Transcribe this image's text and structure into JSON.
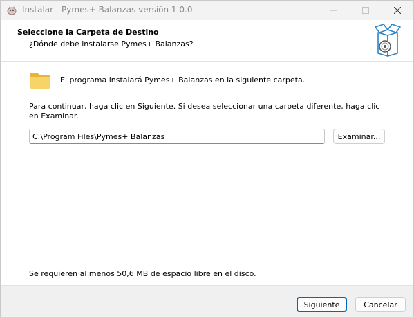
{
  "window": {
    "title": "Instalar - Pymes+ Balanzas versión 1.0.0"
  },
  "header": {
    "title": "Seleccione la Carpeta de Destino",
    "subtitle": "¿Dónde debe instalarse Pymes+ Balanzas?"
  },
  "body": {
    "folder_message": "El programa instalará Pymes+ Balanzas en la siguiente carpeta.",
    "instructions": "Para continuar, haga clic en Siguiente. Si desea seleccionar una carpeta diferente, haga clic en Examinar.",
    "path_value": "C:\\Program Files\\Pymes+ Balanzas",
    "browse_label": "Examinar...",
    "space_required": "Se requieren al menos 50,6 MB de espacio libre en el disco."
  },
  "footer": {
    "next_label": "Siguiente",
    "cancel_label": "Cancelar"
  },
  "icons": {
    "app": "installer-app-icon",
    "folder": "folder-icon",
    "box": "software-box-icon"
  },
  "colors": {
    "accent": "#0067c0",
    "folder": "#f4c94a"
  }
}
